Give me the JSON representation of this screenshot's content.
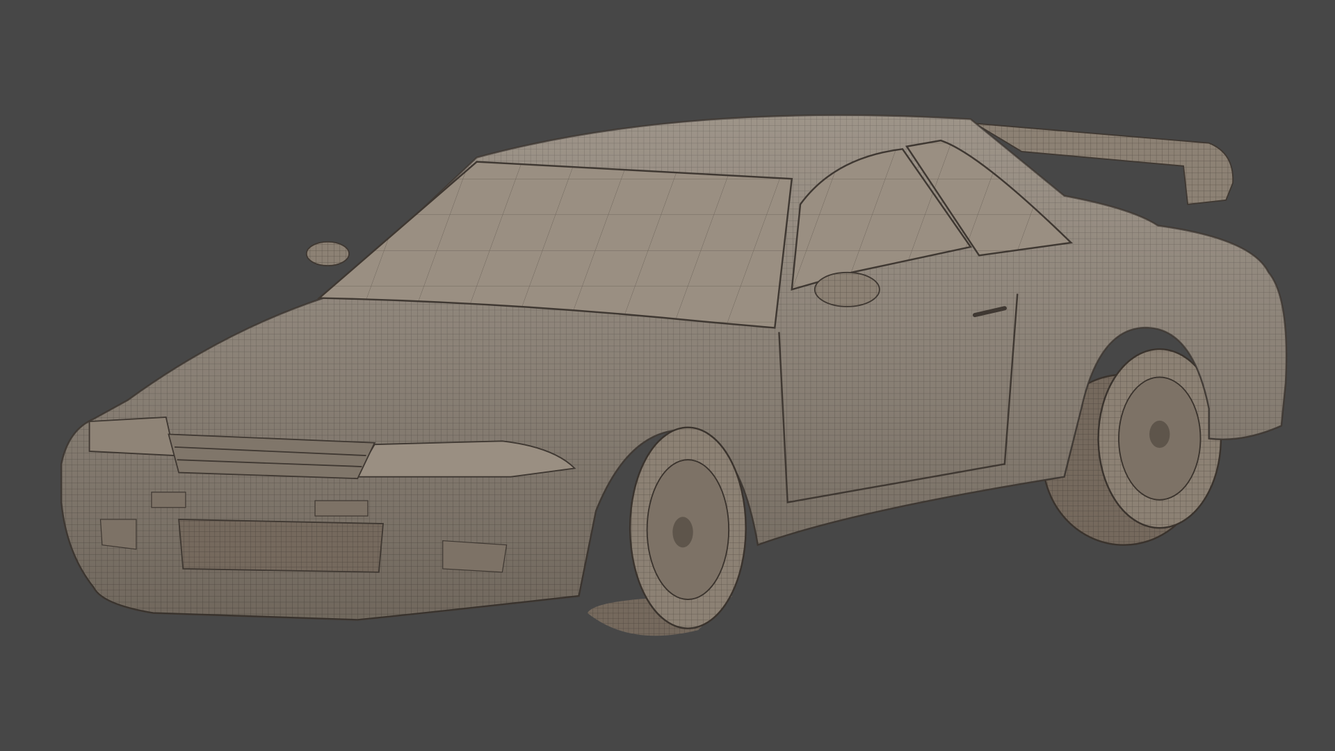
{
  "viewport": {
    "background_color": "#474747",
    "model_color": "#8c8174",
    "model_shadow_color": "#6e655b",
    "model_highlight_color": "#a89d90",
    "wire_color": "#4e463e",
    "glass_color": "#9a8f82"
  }
}
